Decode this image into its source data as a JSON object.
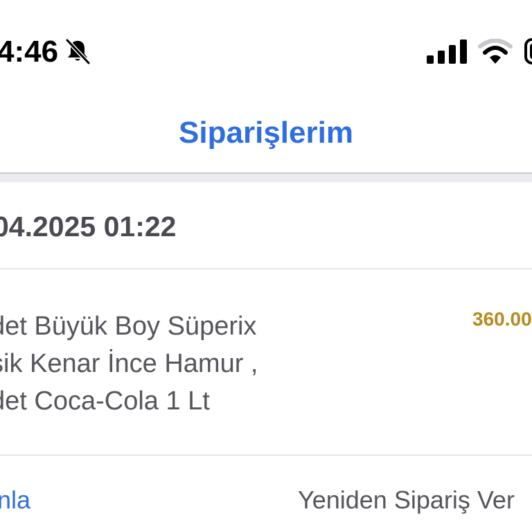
{
  "status_bar": {
    "time": "4:46",
    "icons": [
      "bell-slash-icon",
      "signal-icon",
      "wifi-icon",
      "battery-icon"
    ]
  },
  "nav": {
    "title": "Siparişlerim"
  },
  "order": {
    "date": "04.2025 01:22",
    "items": [
      "det Büyük Boy Süperix",
      "sik Kenar İnce Hamur ,",
      "det Coca-Cola 1 Lt"
    ],
    "price": "360.00",
    "actions": {
      "rate_label": "nla",
      "reorder_label": "Yeniden Sipariş Ver"
    }
  },
  "colors": {
    "accent": "#2f6ee0",
    "price": "#b58a1e",
    "text_primary": "#4a4a52",
    "text_secondary": "#55555c",
    "divider": "#e6e6ea"
  }
}
